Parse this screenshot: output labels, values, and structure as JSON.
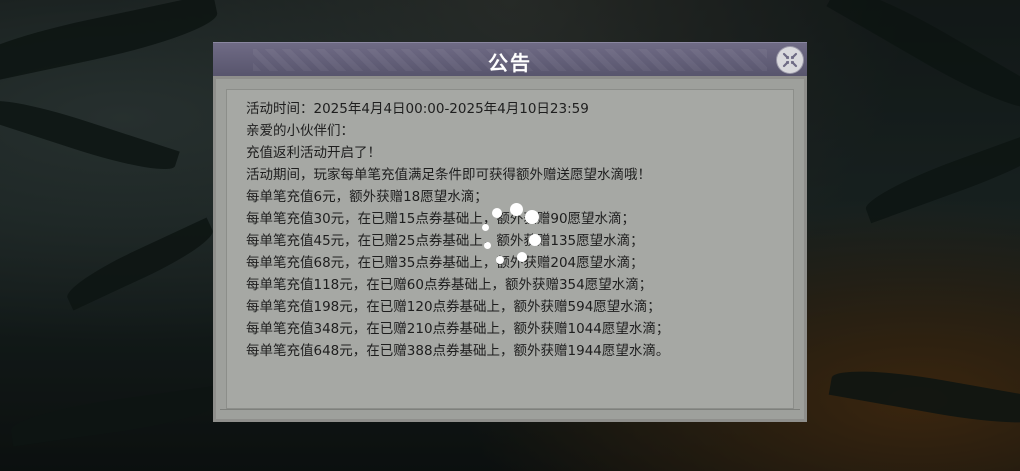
{
  "dialog": {
    "title": "公告",
    "close_icon": "close-icon",
    "lines": [
      "活动时间：2025年4月4日00:00-2025年4月10日23:59",
      "亲爱的小伙伴们：",
      "充值返利活动开启了！",
      "活动期间，玩家每单笔充值满足条件即可获得额外赠送愿望水滴哦！",
      "每单笔充值6元，额外获赠18愿望水滴；",
      "每单笔充值30元，在已赠15点券基础上，额外获赠90愿望水滴；",
      "每单笔充值45元，在已赠25点券基础上，额外获赠135愿望水滴；",
      "每单笔充值68元，在已赠35点券基础上，额外获赠204愿望水滴；",
      "每单笔充值118元，在已赠60点券基础上，额外获赠354愿望水滴；",
      "每单笔充值198元，在已赠120点券基础上，额外获赠594愿望水滴；",
      "每单笔充值348元，在已赠210点券基础上，额外获赠1044愿望水滴；",
      "每单笔充值648元，在已赠388点券基础上，额外获赠1944愿望水滴。"
    ]
  },
  "loading_indicator": "loading-spinner-icon",
  "colors": {
    "title_bar": "#6f6b85",
    "panel": "#a6a8a4",
    "text": "#1e1e1e"
  }
}
